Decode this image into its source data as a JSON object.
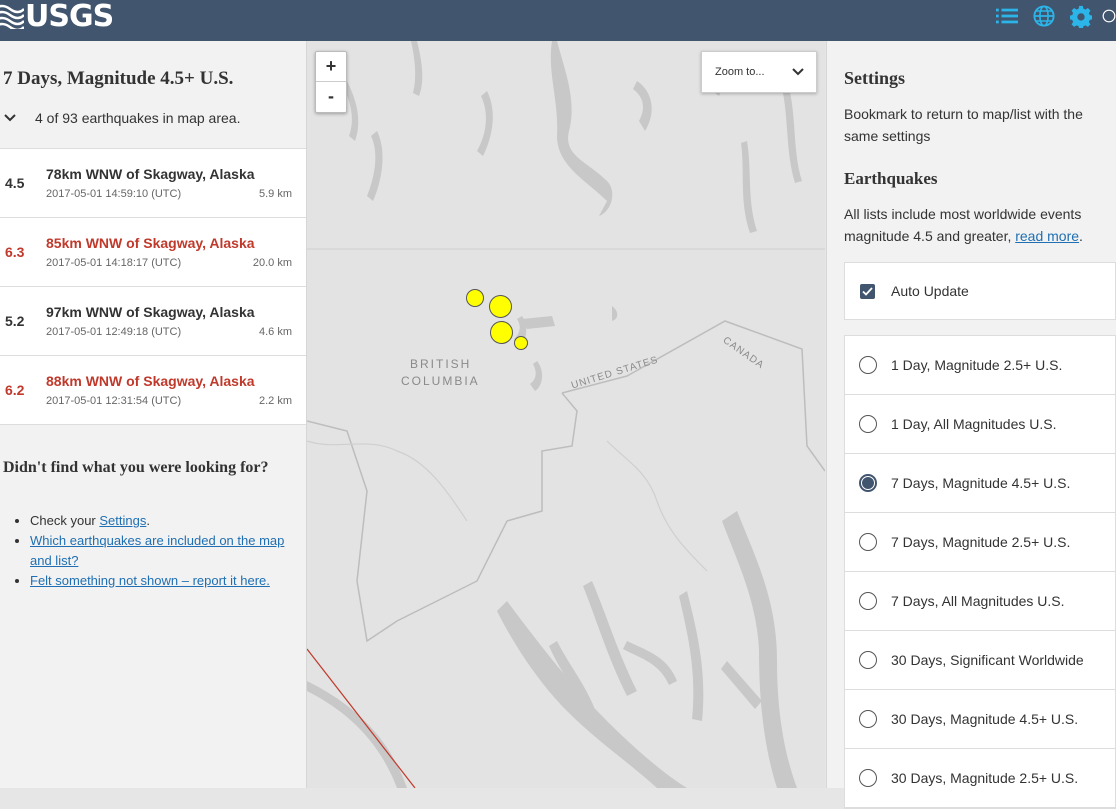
{
  "header": {
    "logo_text": "USGS",
    "icons": [
      "list-icon",
      "globe-icon",
      "gear-icon",
      "info-icon"
    ],
    "bg_color": "#41556f",
    "accent_color": "#2bb5e8"
  },
  "list": {
    "title": "7 Days, Magnitude 4.5+ U.S.",
    "count_text": "4 of 93 earthquakes in map area.",
    "earthquakes": [
      {
        "mag": "4.5",
        "place": "78km WNW of Skagway, Alaska",
        "time": "2017-05-01 14:59:10 (UTC)",
        "depth": "5.9 km"
      },
      {
        "mag": "6.3",
        "place": "85km WNW of Skagway, Alaska",
        "time": "2017-05-01 14:18:17 (UTC)",
        "depth": "20.0 km"
      },
      {
        "mag": "5.2",
        "place": "97km WNW of Skagway, Alaska",
        "time": "2017-05-01 12:49:18 (UTC)",
        "depth": "4.6 km"
      },
      {
        "mag": "6.2",
        "place": "88km WNW of Skagway, Alaska",
        "time": "2017-05-01 12:31:54 (UTC)",
        "depth": "2.2 km"
      }
    ],
    "help": {
      "heading": "Didn't find what you were looking for?",
      "check_prefix": "Check your ",
      "settings_link": "Settings",
      "check_suffix": ".",
      "which_link": "Which earthquakes are included on the map and list?",
      "felt_link": "Felt something not shown – report it here."
    }
  },
  "map": {
    "zoom_in": "+",
    "zoom_out": "-",
    "zoom_to": "Zoom to...",
    "labels": {
      "bc_line1": "BRITISH",
      "bc_line2": "COLUMBIA",
      "canada": "CANADA",
      "us": "UNITED STATES"
    },
    "marker_color": "#ffff00"
  },
  "settings": {
    "title": "Settings",
    "bookmark_text": "Bookmark to return to map/list with the same settings",
    "earthquakes_heading": "Earthquakes",
    "lists_text_prefix": "All lists include most worldwide events magnitude 4.5 and greater, ",
    "read_more": "read more",
    "lists_text_suffix": ".",
    "auto_update": "Auto Update",
    "feeds": [
      {
        "label": "1 Day, Magnitude 2.5+ U.S.",
        "selected": false
      },
      {
        "label": "1 Day, All Magnitudes U.S.",
        "selected": false
      },
      {
        "label": "7 Days, Magnitude 4.5+ U.S.",
        "selected": true
      },
      {
        "label": "7 Days, Magnitude 2.5+ U.S.",
        "selected": false
      },
      {
        "label": "7 Days, All Magnitudes U.S.",
        "selected": false
      },
      {
        "label": "30 Days, Significant Worldwide",
        "selected": false
      },
      {
        "label": "30 Days, Magnitude 4.5+ U.S.",
        "selected": false
      },
      {
        "label": "30 Days, Magnitude 2.5+ U.S.",
        "selected": false
      }
    ]
  }
}
